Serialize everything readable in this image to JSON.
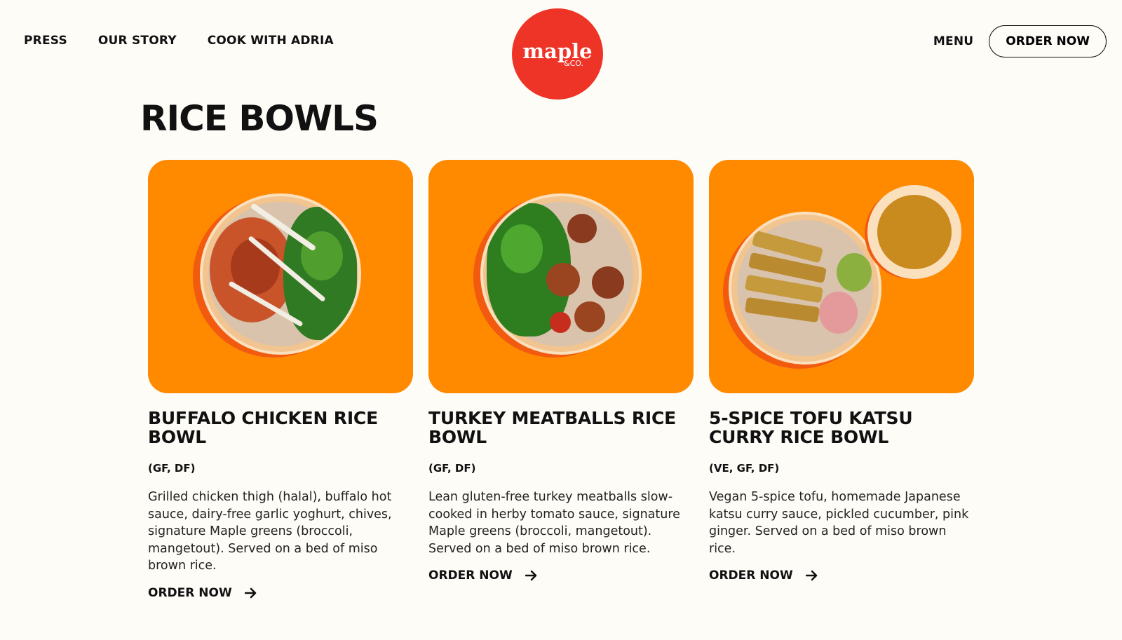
{
  "header": {
    "nav_left": [
      "PRESS",
      "OUR STORY",
      "COOK WITH ADRIA"
    ],
    "logo": {
      "word": "maple",
      "sub": "&CO."
    },
    "menu_label": "MENU",
    "order_label": "ORDER NOW"
  },
  "page": {
    "title": "RICE BOWLS"
  },
  "colors": {
    "card_bg": "#ff8a00",
    "logo_bg": "#ee3427",
    "page_bg": "#fefcf7"
  },
  "products": [
    {
      "name": "BUFFALO CHICKEN RICE BOWL",
      "tags": "(GF, DF)",
      "description": "Grilled chicken thigh (halal), buffalo hot sauce, dairy-free garlic yoghurt, chives, signature Maple greens (broccoli, mangetout). Served on a bed of miso brown rice.",
      "cta": "ORDER NOW"
    },
    {
      "name": "TURKEY MEATBALLS RICE BOWL",
      "tags": "(GF, DF)",
      "description": "Lean gluten-free turkey meatballs slow-cooked in herby tomato sauce, signature Maple greens (broccoli, mangetout). Served on a bed of miso brown rice.",
      "cta": "ORDER NOW"
    },
    {
      "name": "5-SPICE TOFU KATSU CURRY RICE BOWL",
      "tags": "(VE, GF, DF)",
      "description": "Vegan 5-spice tofu, homemade Japanese katsu curry sauce, pickled cucumber, pink ginger. Served on a bed of miso brown rice.",
      "cta": "ORDER NOW"
    }
  ]
}
